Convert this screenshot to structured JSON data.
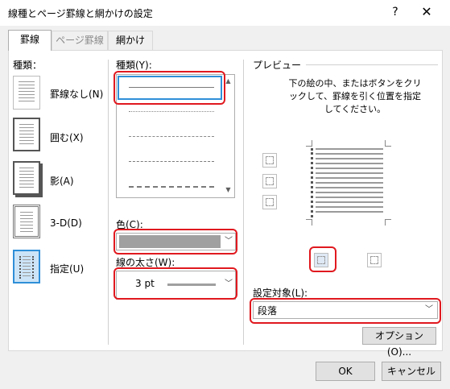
{
  "window": {
    "title": "線種とページ罫線と網かけの設定",
    "help": "?",
    "close": "✕"
  },
  "tabs": [
    {
      "label": "罫線",
      "active": true
    },
    {
      "label": "ページ罫線",
      "active": false
    },
    {
      "label": "網かけ",
      "active": false
    }
  ],
  "settings": {
    "label": "種類：",
    "items": [
      {
        "label": "罫線なし(N)"
      },
      {
        "label": "囲む(X)"
      },
      {
        "label": "影(A)"
      },
      {
        "label": "3-D(D)"
      },
      {
        "label": "指定(U)",
        "selected": true
      }
    ]
  },
  "style": {
    "label": "種類(Y):"
  },
  "color": {
    "label": "色(C):",
    "value_color": "#a0a0a0"
  },
  "width": {
    "label": "線の太さ(W):",
    "value": "3 pt"
  },
  "preview": {
    "label": "プレビュー",
    "instructions": "下の絵の中、またはボタンをクリックして、罫線を引く位置を指定してください。"
  },
  "apply_to": {
    "label": "設定対象(L):",
    "value": "段落"
  },
  "buttons": {
    "options": "オプション(O)...",
    "ok": "OK",
    "cancel": "キャンセル"
  },
  "colors": {
    "highlight": "#e0191f",
    "selection": "#2f8fd8"
  }
}
